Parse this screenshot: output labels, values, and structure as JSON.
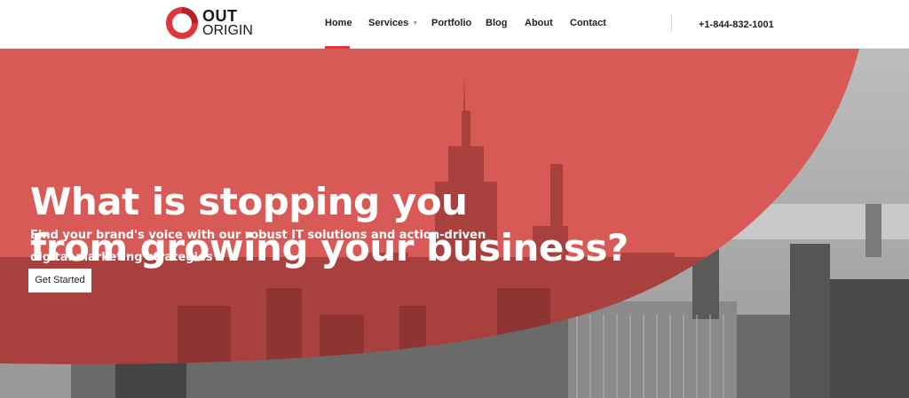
{
  "brand": {
    "line1": "OUT",
    "line2": "ORIGIN",
    "logo_icon": "ring-logo-icon",
    "accent_color": "#e0353a"
  },
  "nav": {
    "items": [
      {
        "label": "Home",
        "active": true
      },
      {
        "label": "Services",
        "has_dropdown": true
      },
      {
        "label": "Portfolio"
      },
      {
        "label": "Blog"
      },
      {
        "label": "About"
      },
      {
        "label": "Contact"
      }
    ],
    "dropdown_icon": "caret-down-icon",
    "phone": "+1-844-832-1001"
  },
  "hero": {
    "title_line1": "What is stopping you",
    "title_line2": "from growing your business?",
    "subtitle_line1": "Find your brand's voice with our robust IT solutions and action-driven",
    "subtitle_line2": "digital marketing strategies",
    "cta_label": "Get Started",
    "overlay_color": "#d9534f",
    "background": "city-skyline-image"
  }
}
